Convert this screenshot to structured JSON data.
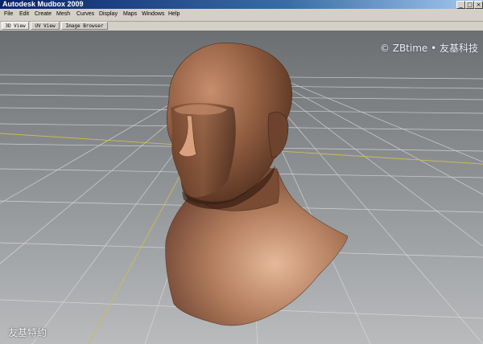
{
  "window": {
    "title": "Autodesk Mudbox 2009",
    "buttons": {
      "minimize": "_",
      "restore": "□",
      "close": "×"
    }
  },
  "menu": {
    "items": [
      "File",
      "Edit",
      "Create",
      "Mesh",
      "Curves",
      "Display",
      "Maps",
      "Windows",
      "Help"
    ]
  },
  "tabs": {
    "items": [
      "3D View",
      "UV View",
      "Image Browser"
    ],
    "active": "3D View"
  },
  "watermarks": {
    "top": "© ZBtime • 友基科技",
    "bottom": "友基特约"
  },
  "viewport": {
    "content": "head-and-shoulders base mesh on grid",
    "colors": {
      "skin": "#8a5a3e",
      "grid": "#d8d8d8",
      "axis": "#c8b84a"
    }
  }
}
